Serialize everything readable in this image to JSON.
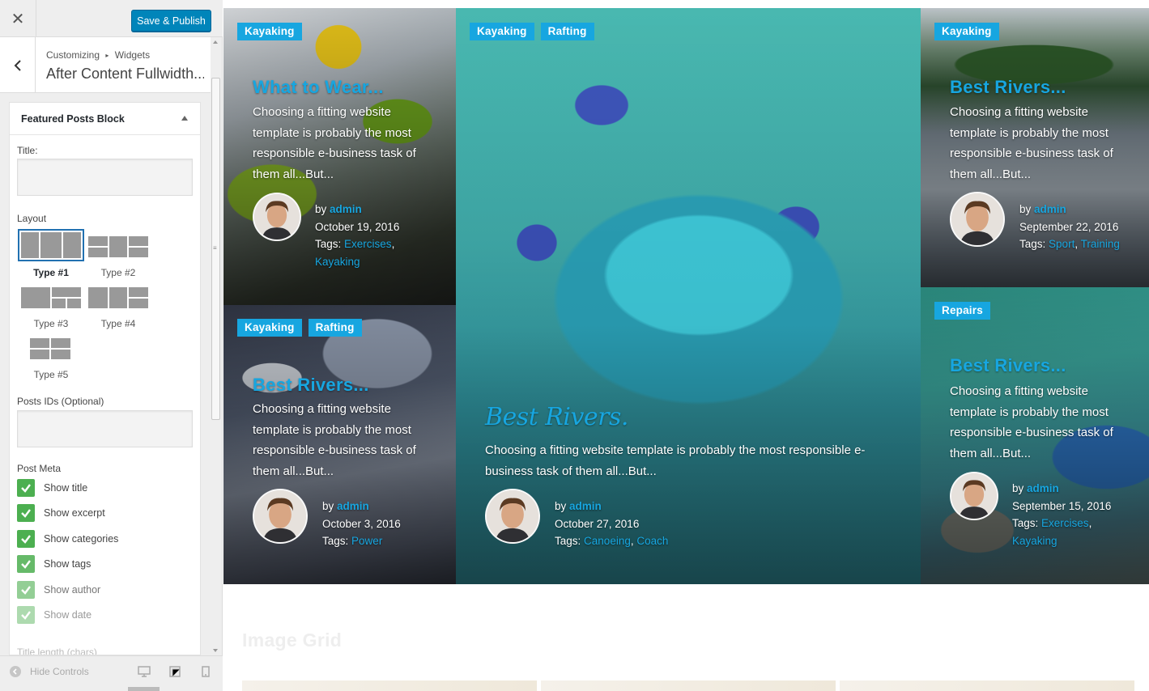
{
  "customizer": {
    "close_icon": "close-icon",
    "publish_label": "Save & Publish",
    "breadcrumb": {
      "parent": "Customizing",
      "separator": "▸",
      "current": "Widgets"
    },
    "section_title": "After Content Fullwidth...",
    "widget": {
      "title": "Featured Posts Block",
      "title_label": "Title:",
      "title_value": "",
      "layout_label": "Layout",
      "layouts": [
        {
          "label": "Type #1",
          "selected": true
        },
        {
          "label": "Type #2",
          "selected": false
        },
        {
          "label": "Type #3",
          "selected": false
        },
        {
          "label": "Type #4",
          "selected": false
        },
        {
          "label": "Type #5",
          "selected": false
        }
      ],
      "posts_ids_label": "Posts IDs (Optional)",
      "posts_ids_value": "",
      "post_meta_label": "Post Meta",
      "post_meta": [
        {
          "label": "Show title",
          "checked": true
        },
        {
          "label": "Show excerpt",
          "checked": true
        },
        {
          "label": "Show categories",
          "checked": true
        },
        {
          "label": "Show tags",
          "checked": true
        },
        {
          "label": "Show author",
          "checked": true
        },
        {
          "label": "Show date",
          "checked": true
        }
      ],
      "title_length_label": "Title length (chars)"
    },
    "footer": {
      "hide_controls": "Hide Controls"
    }
  },
  "preview": {
    "accent_color": "#17a6e0",
    "posts": [
      {
        "categories": [
          "Kayaking"
        ],
        "title": "What to Wear...",
        "excerpt": "Choosing a fitting website template is probably the most responsible e-business task of them all...But...",
        "by": "by",
        "author": "admin",
        "date": "October 19, 2016",
        "tags_label": "Tags:",
        "tags": [
          "Exercises",
          "Kayaking"
        ]
      },
      {
        "categories": [
          "Kayaking",
          "Rafting"
        ],
        "title": "Best Rivers...",
        "excerpt": "Choosing a fitting website template is probably the most responsible e-business task of them all...But...",
        "by": "by",
        "author": "admin",
        "date": "October 3, 2016",
        "tags_label": "Tags:",
        "tags": [
          "Power"
        ]
      },
      {
        "categories": [
          "Kayaking",
          "Rafting"
        ],
        "title": "Best Rivers.",
        "excerpt": "Choosing a fitting website template is probably the most responsible e-business task of them all...But...",
        "by": "by",
        "author": "admin",
        "date": "October 27, 2016",
        "tags_label": "Tags:",
        "tags": [
          "Canoeing",
          "Coach"
        ]
      },
      {
        "categories": [
          "Kayaking"
        ],
        "title": "Best Rivers...",
        "excerpt": "Choosing a fitting website template is probably the most responsible e-business task of them all...But...",
        "by": "by",
        "author": "admin",
        "date": "September 22, 2016",
        "tags_label": "Tags:",
        "tags": [
          "Sport",
          "Training"
        ]
      },
      {
        "categories": [
          "Repairs"
        ],
        "title": "Best Rivers...",
        "excerpt": "Choosing a fitting website template is probably the most responsible e-business task of them all...But...",
        "by": "by",
        "author": "admin",
        "date": "September 15, 2016",
        "tags_label": "Tags:",
        "tags": [
          "Exercises",
          "Kayaking"
        ]
      }
    ],
    "next_section_title": "Image Grid"
  }
}
